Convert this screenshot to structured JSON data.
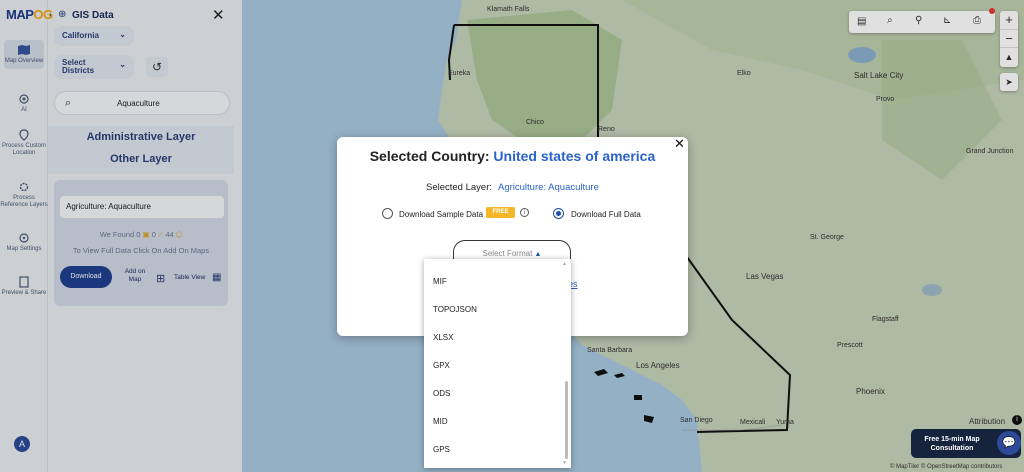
{
  "app": {
    "logo_main": "MAP",
    "logo_accent": "OG",
    "section_title": "GIS Data"
  },
  "rail": [
    {
      "label": "Map Overview"
    },
    {
      "label": "AI"
    },
    {
      "label": "Process Custom Location"
    },
    {
      "label": "Process Reference Layers"
    },
    {
      "label": "Map Settings"
    },
    {
      "label": "Preview & Share"
    }
  ],
  "avatar_letter": "A",
  "panel": {
    "state_select": "California",
    "district_select": "Select Districts",
    "search_value": "Aquaculture",
    "admin_layer": "Administrative Layer",
    "other_layer": "Other Layer",
    "card_layer": "Agriculture: Aquaculture",
    "found_text": "We Found",
    "count_a": "0",
    "count_b": "0",
    "count_c": "44",
    "info_text": "To View Full Data Click On Add On Maps",
    "download_label": "Download",
    "addmap_label": "Add on Map",
    "table_label": "Table View"
  },
  "modal": {
    "title_prefix": "Selected Country:",
    "country": "United states of america",
    "layer_label": "Selected Layer:",
    "layer_value": "Agriculture: Aquaculture",
    "sample_label": "Download Sample Data",
    "free_badge": "FREE",
    "full_label": "Download Full Data",
    "format_placeholder": "Select Format",
    "hidden_link_tail": "es"
  },
  "formats": [
    "MIF",
    "TOPOJSON",
    "XLSX",
    "GPX",
    "ODS",
    "MID",
    "GPS"
  ],
  "map": {
    "cities": [
      {
        "name": "Klamath Falls"
      },
      {
        "name": "Eureka"
      },
      {
        "name": "Elko"
      },
      {
        "name": "Salt Lake City"
      },
      {
        "name": "Provo"
      },
      {
        "name": "Chico"
      },
      {
        "name": "Reno"
      },
      {
        "name": "Grand Junction"
      },
      {
        "name": "St. George"
      },
      {
        "name": "Las Vegas"
      },
      {
        "name": "Flagstaff"
      },
      {
        "name": "Prescott"
      },
      {
        "name": "Phoenix"
      },
      {
        "name": "Santa Barbara"
      },
      {
        "name": "Los Angeles"
      },
      {
        "name": "San Diego"
      },
      {
        "name": "Mexicali"
      },
      {
        "name": "Yuma"
      }
    ],
    "attribution": "Attribution",
    "copyright": "© MapTiler © OpenStreetMap contributors"
  },
  "consult": {
    "line1": "Free 15-min Map",
    "line2": "Consultation"
  },
  "colors": {
    "brand": "#1d3a8a",
    "accent": "#f3a712",
    "link": "#2a63c9",
    "button": "#1f3f8f"
  }
}
